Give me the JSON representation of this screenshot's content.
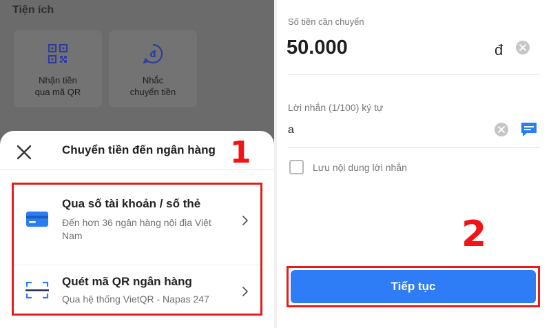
{
  "left": {
    "utilities": {
      "title": "Tiện ích",
      "cards": [
        {
          "line1": "Nhận tiền",
          "line2": "qua mã QR",
          "icon": "qr-code-icon"
        },
        {
          "line1": "Nhắc",
          "line2": "chuyển tiền",
          "icon": "dong-reminder-icon"
        }
      ]
    },
    "sheet": {
      "title": "Chuyển tiền đến ngân hàng",
      "annotation": "1",
      "options": [
        {
          "title": "Qua số tài khoản / số thẻ",
          "subtitle": "Đến hơn 36 ngân hàng nội địa Việt Nam",
          "icon": "bank-card-icon"
        },
        {
          "title": "Quét mã QR ngân hàng",
          "subtitle": "Qua hệ thống VietQR - Napas 247",
          "icon": "scan-qr-icon"
        }
      ]
    }
  },
  "right": {
    "amount": {
      "label": "Số tiền cần chuyển",
      "value": "50.000",
      "currency": "đ"
    },
    "message": {
      "label": "Lời nhắn (1/100) ký tự",
      "value": "a"
    },
    "save_message": {
      "label": "Lưu nội dung lời nhắn",
      "checked": false
    },
    "annotation": "2",
    "continue_label": "Tiếp tục"
  },
  "colors": {
    "accent": "#2e7cf6",
    "highlight": "#e81b1b",
    "overlay": "#6b6b6b"
  }
}
